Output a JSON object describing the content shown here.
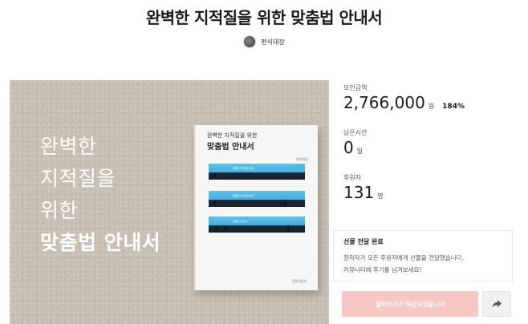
{
  "project": {
    "title": "완벽한 지적질을 위한 맞춤법 안내서",
    "creator": "편식대장"
  },
  "hero": {
    "lines": [
      "완벽한",
      "지적질을",
      "위한",
      "맞춤법 안내서"
    ],
    "book": {
      "subtitle": "완벽한 지적질을 위한",
      "main_title": "맞춤법 안내서",
      "author": "편식대장",
      "publisher": "텀블벅출판",
      "strip_texts": [
        "완벽한 지적질을 위한",
        "맞춤법 안내서를 읽고",
        "맞춤법 안내서"
      ]
    }
  },
  "stats": {
    "funding": {
      "label": "모인금액",
      "value": "2,766,000",
      "unit": "원",
      "percent": "184%"
    },
    "time": {
      "label": "남은시간",
      "value": "0",
      "unit": "일"
    },
    "backers": {
      "label": "후원자",
      "value": "131",
      "unit": "명"
    }
  },
  "gift": {
    "title": "선물 전달 완료",
    "description": "창작자가 모든 후원자에게 선물을 전달했습니다.\n커뮤니티에 후기를 남겨보세요!"
  },
  "actions": {
    "cta_label": "밀어주기가 마감되었습니다",
    "share_icon": "share-arrow-icon"
  },
  "colors": {
    "cta_background": "#f9c7c3",
    "hero_background": "#c8bfb3",
    "book_sky": "#4aaedc"
  }
}
